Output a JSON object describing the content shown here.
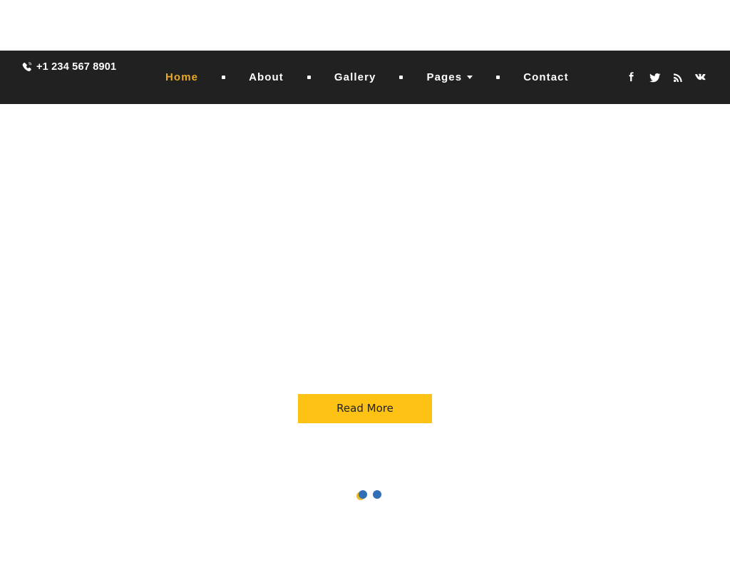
{
  "header": {
    "contact": {
      "icon": "phone-volume-icon",
      "phone": "+1 234 567 8901"
    },
    "nav": {
      "separator_icon": "square-dot-separator",
      "items": [
        {
          "label": "Home",
          "active": true,
          "has_dropdown": false
        },
        {
          "label": "About",
          "active": false,
          "has_dropdown": false
        },
        {
          "label": "Gallery",
          "active": false,
          "has_dropdown": false
        },
        {
          "label": "Pages",
          "active": false,
          "has_dropdown": true
        },
        {
          "label": "Contact",
          "active": false,
          "has_dropdown": false
        }
      ]
    },
    "social": [
      {
        "name": "facebook-icon",
        "label": "Facebook"
      },
      {
        "name": "twitter-icon",
        "label": "Twitter"
      },
      {
        "name": "rss-icon",
        "label": "RSS"
      },
      {
        "name": "vk-icon",
        "label": "VK"
      }
    ]
  },
  "hero": {
    "cta_label": "Read More",
    "carousel": {
      "dots": [
        {
          "color": "#2f6fb5",
          "active": true
        },
        {
          "color": "#2f6fb5",
          "active": false
        }
      ],
      "accent_color": "#f0bc2a"
    }
  },
  "colors": {
    "header_bg": "#212121",
    "accent": "#e9a825",
    "button_bg": "#fdc214",
    "button_text": "#222222",
    "nav_text": "#ffffff",
    "page_bg": "#ffffff"
  }
}
